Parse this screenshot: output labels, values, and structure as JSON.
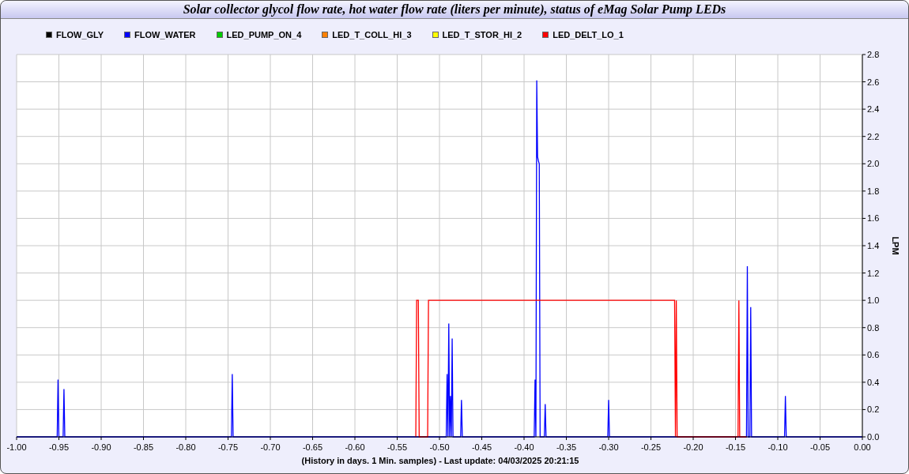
{
  "title": "Solar collector glycol flow rate, hot water flow rate (liters per minute), status of eMag Solar Pump LEDs",
  "chart_data": {
    "type": "line",
    "xlabel": "(History in days. 1 Min. samples) - Last update: 04/03/2025 20:21:15",
    "ylabel": "LPM",
    "x": [
      -1.0,
      -0.952,
      -0.951,
      -0.95,
      -0.945,
      -0.944,
      -0.943,
      -0.746,
      -0.745,
      -0.744,
      -0.528,
      -0.527,
      -0.525,
      -0.524,
      -0.514,
      -0.513,
      -0.492,
      -0.491,
      -0.49,
      -0.489,
      -0.488,
      -0.487,
      -0.486,
      -0.485,
      -0.484,
      -0.475,
      -0.474,
      -0.473,
      -0.388,
      -0.387,
      -0.386,
      -0.385,
      -0.384,
      -0.383,
      -0.382,
      -0.381,
      -0.376,
      -0.375,
      -0.374,
      -0.301,
      -0.3,
      -0.299,
      -0.222,
      -0.221,
      -0.22,
      -0.219,
      -0.147,
      -0.146,
      -0.145,
      -0.137,
      -0.136,
      -0.135,
      -0.133,
      -0.132,
      -0.131,
      -0.092,
      -0.091,
      -0.09,
      0.0
    ],
    "series": [
      {
        "name": "FLOW_GLY",
        "color": "#000000",
        "values": [
          null,
          null,
          null,
          null,
          null,
          null,
          null,
          null,
          null,
          null,
          null,
          null,
          null,
          null,
          null,
          null,
          null,
          null,
          null,
          null,
          null,
          null,
          null,
          null,
          null,
          null,
          null,
          null,
          null,
          null,
          null,
          null,
          null,
          null,
          null,
          null,
          null,
          null,
          null,
          null,
          null,
          null,
          null,
          null,
          null,
          null,
          null,
          null,
          null,
          null,
          null,
          null,
          null,
          null,
          null,
          null,
          null,
          null,
          null
        ]
      },
      {
        "name": "FLOW_WATER",
        "color": "#0000ff",
        "values": [
          0,
          0,
          0.42,
          0,
          0,
          0.35,
          0,
          0,
          0.46,
          0,
          0,
          0,
          0,
          0,
          0,
          0,
          0,
          0.46,
          0,
          0.83,
          0,
          0.3,
          0,
          0.72,
          0,
          0,
          0.27,
          0,
          0,
          0.42,
          0,
          2.61,
          2.05,
          2.02,
          2.0,
          0,
          0,
          0.24,
          0,
          0,
          0.27,
          0,
          0,
          0,
          0,
          0,
          0,
          0,
          0,
          0,
          1.25,
          0,
          0,
          0.95,
          0,
          0,
          0.3,
          0,
          0
        ]
      },
      {
        "name": "LED_PUMP_ON_4",
        "color": "#00cc00",
        "values": [
          null,
          null,
          null,
          null,
          null,
          null,
          null,
          null,
          null,
          null,
          null,
          null,
          null,
          null,
          null,
          null,
          null,
          null,
          null,
          null,
          null,
          null,
          null,
          null,
          null,
          null,
          null,
          null,
          null,
          null,
          null,
          null,
          null,
          null,
          null,
          null,
          null,
          null,
          null,
          null,
          null,
          null,
          null,
          null,
          null,
          null,
          null,
          null,
          null,
          null,
          null,
          null,
          null,
          null,
          null,
          null,
          null,
          null,
          null
        ]
      },
      {
        "name": "LED_T_COLL_HI_3",
        "color": "#ff8000",
        "values": [
          null,
          null,
          null,
          null,
          null,
          null,
          null,
          null,
          null,
          null,
          null,
          null,
          null,
          null,
          null,
          null,
          null,
          null,
          null,
          null,
          null,
          null,
          null,
          null,
          null,
          null,
          null,
          null,
          null,
          null,
          null,
          null,
          null,
          null,
          null,
          null,
          null,
          null,
          null,
          null,
          null,
          null,
          null,
          null,
          null,
          null,
          null,
          null,
          null,
          null,
          null,
          null,
          null,
          null,
          null,
          null,
          null,
          null,
          null
        ]
      },
      {
        "name": "LED_T_STOR_HI_2",
        "color": "#ffff00",
        "values": [
          null,
          null,
          null,
          null,
          null,
          null,
          null,
          null,
          null,
          null,
          null,
          null,
          null,
          null,
          null,
          null,
          null,
          null,
          null,
          null,
          null,
          null,
          null,
          null,
          null,
          null,
          null,
          null,
          null,
          null,
          null,
          null,
          null,
          null,
          null,
          null,
          null,
          null,
          null,
          null,
          null,
          null,
          null,
          null,
          null,
          null,
          null,
          null,
          null,
          null,
          null,
          null,
          null,
          null,
          null,
          null,
          null,
          null,
          null
        ]
      },
      {
        "name": "LED_DELT_LO_1",
        "color": "#ff0000",
        "values": [
          null,
          null,
          null,
          null,
          null,
          null,
          null,
          null,
          null,
          null,
          0,
          1,
          1,
          0,
          0,
          1,
          1,
          1,
          1,
          1,
          1,
          1,
          1,
          1,
          1,
          1,
          1,
          1,
          1,
          1,
          1,
          1,
          1,
          1,
          1,
          1,
          1,
          1,
          1,
          1,
          1,
          1,
          1,
          0,
          1,
          0,
          0,
          1,
          0,
          0,
          null,
          null,
          null,
          null,
          null,
          null,
          null,
          null,
          null
        ]
      }
    ],
    "xlim": [
      -1.0,
      0.0
    ],
    "ylim": [
      0,
      2.8
    ],
    "grid": true,
    "xticks": [
      {
        "value": -1.0,
        "label": "-1.00"
      },
      -0.95,
      {
        "value": -0.9,
        "label": "-0.90"
      },
      -0.85,
      {
        "value": -0.8,
        "label": "-0.80"
      },
      -0.75,
      {
        "value": -0.7,
        "label": "-0.70"
      },
      -0.65,
      {
        "value": -0.6,
        "label": "-0.60"
      },
      -0.55,
      {
        "value": -0.5,
        "label": "-0.50"
      },
      -0.45,
      {
        "value": -0.4,
        "label": "-0.40"
      },
      -0.35,
      {
        "value": -0.3,
        "label": "-0.30"
      },
      -0.25,
      {
        "value": -0.2,
        "label": "-0.20"
      },
      -0.15,
      {
        "value": -0.1,
        "label": "-0.10"
      },
      -0.05,
      {
        "value": 0.0,
        "label": "0.00"
      }
    ],
    "yticks": [
      {
        "value": 0,
        "label": "0.0"
      },
      0.2,
      0.4,
      0.6,
      0.8,
      {
        "value": 1.0,
        "label": "1.0"
      },
      1.2,
      1.4,
      1.6,
      1.8,
      {
        "value": 2.0,
        "label": "2.0"
      },
      2.2,
      2.4,
      2.6,
      2.8
    ]
  }
}
